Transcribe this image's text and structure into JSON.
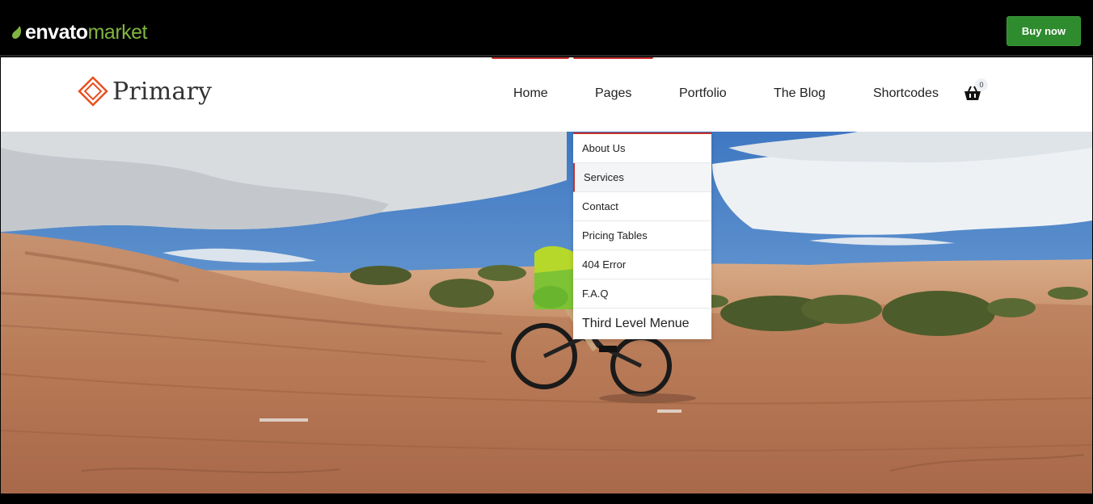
{
  "envato": {
    "logo_word1": "envato",
    "logo_word2": "market",
    "buy_label": "Buy now",
    "accent": "#81b441",
    "button_color": "#2e8b2e"
  },
  "site": {
    "brand_name": "Primary",
    "brand_color": "#e8501f",
    "accent": "#c9302c",
    "nav": [
      {
        "label": "Home"
      },
      {
        "label": "Pages"
      },
      {
        "label": "Portfolio"
      },
      {
        "label": "The Blog"
      },
      {
        "label": "Shortcodes"
      }
    ],
    "cart_icon": "basket-icon",
    "cart_count": "0"
  },
  "dropdown": {
    "items": [
      {
        "label": "About Us"
      },
      {
        "label": "Services",
        "active": true
      },
      {
        "label": "Contact"
      },
      {
        "label": "Pricing Tables"
      },
      {
        "label": "404 Error"
      },
      {
        "label": "F.A.Q"
      },
      {
        "label": "Third Level Menue"
      }
    ]
  },
  "hero": {
    "image": "mountain-biker-desert-photo"
  }
}
